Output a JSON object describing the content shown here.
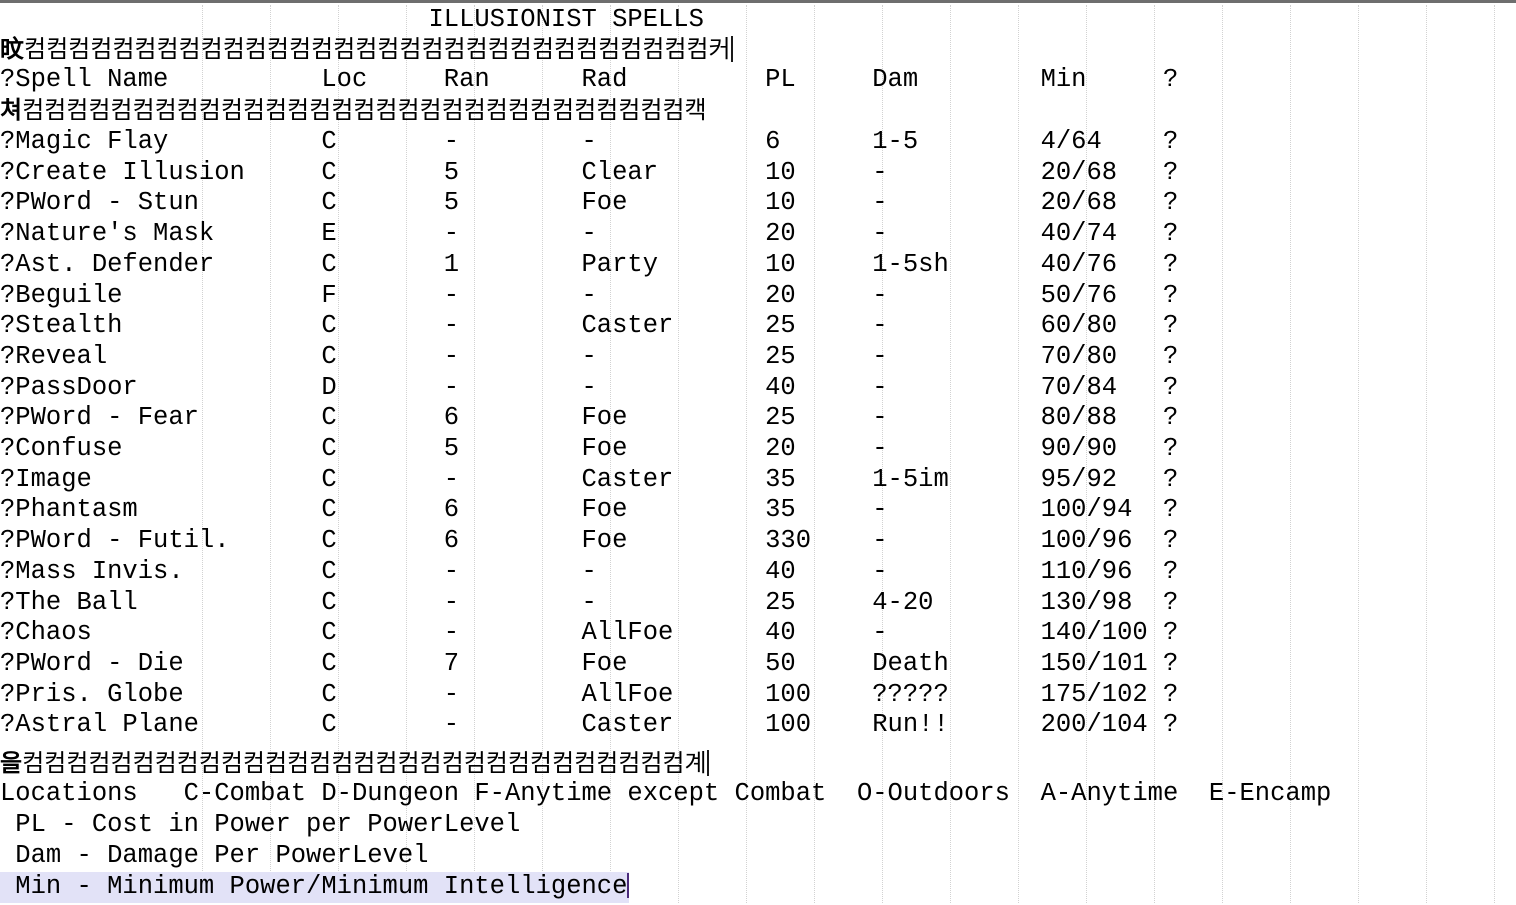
{
  "document": {
    "title": "ILLUSIONIST SPELLS",
    "title_indent": 28,
    "rule_top": {
      "lead": "旼",
      "fill": "컴",
      "fill_count": 31,
      "tail": "커"
    },
    "rule_mid": {
      "lead": "쳐",
      "fill": "컴",
      "fill_count": 30,
      "tail": "캑"
    },
    "rule_bottom": {
      "lead": "을",
      "fill": "컴",
      "fill_count": 30,
      "tail": "계"
    },
    "columns": [
      "?Spell Name",
      "Loc",
      "Ran",
      "Rad",
      "PL",
      "Dam",
      "Min",
      "?"
    ],
    "rows": [
      {
        "name": "?Magic Flay",
        "loc": "C",
        "ran": "-",
        "rad": "-",
        "pl": "6",
        "dam": "1-5",
        "min": "4/64",
        "q": "?"
      },
      {
        "name": "?Create Illusion",
        "loc": "C",
        "ran": "5",
        "rad": "Clear",
        "pl": "10",
        "dam": "-",
        "min": "20/68",
        "q": "?"
      },
      {
        "name": "?PWord - Stun",
        "loc": "C",
        "ran": "5",
        "rad": "Foe",
        "pl": "10",
        "dam": "-",
        "min": "20/68",
        "q": "?"
      },
      {
        "name": "?Nature's Mask",
        "loc": "E",
        "ran": "-",
        "rad": "-",
        "pl": "20",
        "dam": "-",
        "min": "40/74",
        "q": "?"
      },
      {
        "name": "?Ast. Defender",
        "loc": "C",
        "ran": "1",
        "rad": "Party",
        "pl": "10",
        "dam": "1-5sh",
        "min": "40/76",
        "q": "?"
      },
      {
        "name": "?Beguile",
        "loc": "F",
        "ran": "-",
        "rad": "-",
        "pl": "20",
        "dam": "-",
        "min": "50/76",
        "q": "?"
      },
      {
        "name": "?Stealth",
        "loc": "C",
        "ran": "-",
        "rad": "Caster",
        "pl": "25",
        "dam": "-",
        "min": "60/80",
        "q": "?"
      },
      {
        "name": "?Reveal",
        "loc": "C",
        "ran": "-",
        "rad": "-",
        "pl": "25",
        "dam": "-",
        "min": "70/80",
        "q": "?"
      },
      {
        "name": "?PassDoor",
        "loc": "D",
        "ran": "-",
        "rad": "-",
        "pl": "40",
        "dam": "-",
        "min": "70/84",
        "q": "?"
      },
      {
        "name": "?PWord - Fear",
        "loc": "C",
        "ran": "6",
        "rad": "Foe",
        "pl": "25",
        "dam": "-",
        "min": "80/88",
        "q": "?"
      },
      {
        "name": "?Confuse",
        "loc": "C",
        "ran": "5",
        "rad": "Foe",
        "pl": "20",
        "dam": "-",
        "min": "90/90",
        "q": "?"
      },
      {
        "name": "?Image",
        "loc": "C",
        "ran": "-",
        "rad": "Caster",
        "pl": "35",
        "dam": "1-5im",
        "min": "95/92",
        "q": "?"
      },
      {
        "name": "?Phantasm",
        "loc": "C",
        "ran": "6",
        "rad": "Foe",
        "pl": "35",
        "dam": "-",
        "min": "100/94",
        "q": "?"
      },
      {
        "name": "?PWord - Futil.",
        "loc": "C",
        "ran": "6",
        "rad": "Foe",
        "pl": "330",
        "dam": "-",
        "min": "100/96",
        "q": "?"
      },
      {
        "name": "?Mass Invis.",
        "loc": "C",
        "ran": "-",
        "rad": "-",
        "pl": "40",
        "dam": "-",
        "min": "110/96",
        "q": "?"
      },
      {
        "name": "?The Ball",
        "loc": "C",
        "ran": "-",
        "rad": "-",
        "pl": "25",
        "dam": "4-20",
        "min": "130/98",
        "q": "?"
      },
      {
        "name": "?Chaos",
        "loc": "C",
        "ran": "-",
        "rad": "AllFoe",
        "pl": "40",
        "dam": "-",
        "min": "140/100",
        "q": "?"
      },
      {
        "name": "?PWord - Die",
        "loc": "C",
        "ran": "7",
        "rad": "Foe",
        "pl": "50",
        "dam": "Death",
        "min": "150/101",
        "q": "?"
      },
      {
        "name": "?Pris. Globe",
        "loc": "C",
        "ran": "-",
        "rad": "AllFoe",
        "pl": "100",
        "dam": "?????",
        "min": "175/102",
        "q": "?"
      },
      {
        "name": "?Astral Plane",
        "loc": "C",
        "ran": "-",
        "rad": "Caster",
        "pl": "100",
        "dam": "Run!!",
        "min": "200/104",
        "q": "?"
      }
    ],
    "legend": {
      "locations": "Locations   C-Combat D-Dungeon F-Anytime except Combat  O-Outdoors  A-Anytime  E-Encamp",
      "pl": " PL - Cost in Power per PowerLevel",
      "dam": " Dam - Damage Per PowerLevel",
      "min": " Min - Minimum Power/Minimum Intelligence"
    }
  },
  "colors": {
    "text": "#000000",
    "selection": "#e2e2f7",
    "cursor": "#4b2a7b",
    "guide": "#d2d2d2",
    "top_border": "#6e6e6e"
  }
}
